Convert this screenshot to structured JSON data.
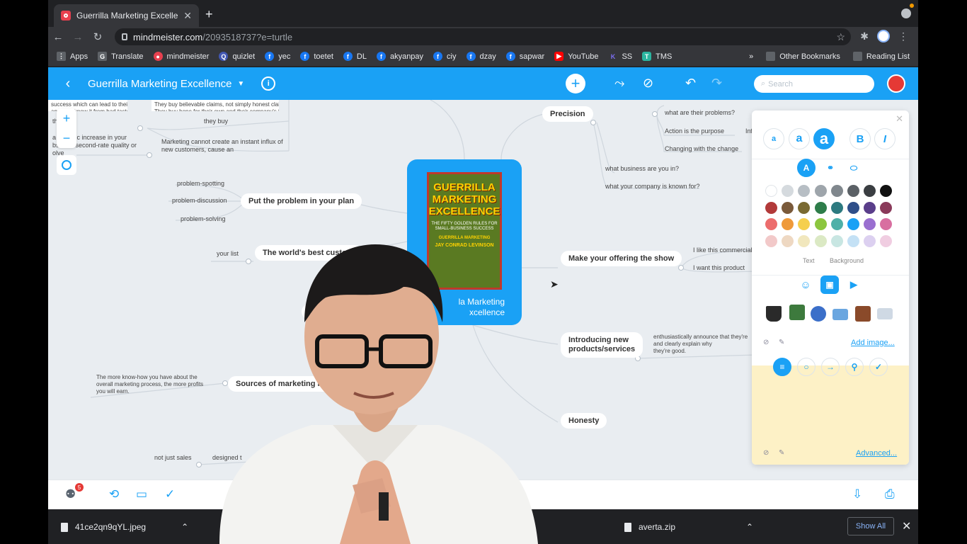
{
  "browser": {
    "tab_title": "Guerrilla Marketing Excellence",
    "url_host": "mindmeister.com",
    "url_path": "/2093518737?e=turtle",
    "bookmarks": [
      {
        "label": "Apps",
        "icon": "apps-grid-icon"
      },
      {
        "label": "Translate",
        "icon": "translate-icon"
      },
      {
        "label": "mindmeister",
        "icon": "mindmeister-icon"
      },
      {
        "label": "quizlet",
        "icon": "quizlet-icon"
      },
      {
        "label": "yec",
        "icon": "facebook-icon"
      },
      {
        "label": "toetet",
        "icon": "facebook-icon"
      },
      {
        "label": "DL",
        "icon": "facebook-icon"
      },
      {
        "label": "akyanpay",
        "icon": "facebook-icon"
      },
      {
        "label": "ciy",
        "icon": "facebook-icon"
      },
      {
        "label": "dzay",
        "icon": "facebook-icon"
      },
      {
        "label": "sapwar",
        "icon": "facebook-icon"
      },
      {
        "label": "YouTube",
        "icon": "youtube-icon"
      },
      {
        "label": "SS",
        "icon": "ss-icon"
      },
      {
        "label": "TMS",
        "icon": "tms-icon"
      }
    ],
    "overflow": "»",
    "other_bookmarks": "Other Bookmarks",
    "reading_list": "Reading List"
  },
  "app": {
    "map_title": "Guerrilla Marketing Excellence",
    "search_placeholder": "Search",
    "accent": "#1aa1f5"
  },
  "mindmap": {
    "center_label": "Guerrilla Marketing Excellence",
    "center_label_visible": "la Marketing\nxcellence",
    "book_title": "GUERRILLA MARKETING EXCELLENCE",
    "book_subtitle": "THE FIFTY GOLDEN RULES FOR SMALL-BUSINESS SUCCESS",
    "book_series": "GUERRILLA MARKETING",
    "book_author": "JAY CONRAD LEVINSON",
    "nodes": {
      "precision": "Precision",
      "put_problem": "Put the problem in your plan",
      "worlds_best": "The world's best custom",
      "make_offering": "Make your offering the show",
      "introducing": "Introducing new\nproducts/services",
      "sources": "Sources of marketing kn",
      "honesty": "Honesty",
      "c_partial": "C"
    },
    "leaves": {
      "they_buy": "they buy",
      "marketing_cannot": "Marketing cannot create an instant influx of\nnew customers, cause an",
      "problem_spotting": "problem-spotting",
      "problem_discussion": "problem-discussion",
      "problem_solving": "problem-solving",
      "your_list": "your list",
      "what_problems": "what are their problems?",
      "action_purpose": "Action is the purpose",
      "inf": "Inf",
      "changing": "Changing with the change",
      "what_business": "what business are you in?",
      "known_for": "what your company is known for?",
      "like_commercial": "I like this commercial",
      "want_product": "I want this product",
      "enthusiastically": "enthusiastically announce that they're\nand clearly explain why\nthey're good.",
      "know_how": "The more know-how you have about the\noverall marketing process, the more profits\nyou will earn.",
      "not_just_sales": "not just sales",
      "designed": "designed t",
      "note_top_left": "success which can lead to theirs.\nand they know it from bad taste.",
      "note_top_mid": "They buy believable claims, not simply honest claims.\nThey buy hope for their own and their company's future.",
      "note_left_a": "th",
      "note_left_b": "a      natic increase in your\nbst      r second-rate quality or\nolve"
    }
  },
  "panel": {
    "font_a_small": "a",
    "font_a_medium": "a",
    "font_a_large": "a",
    "bold": "B",
    "italic": "I",
    "text_label": "Text",
    "background_label": "Background",
    "add_image": "Add image...",
    "advanced": "Advanced...",
    "swatches": [
      "#ffffff",
      "#d5dade",
      "#b7bec4",
      "#9ea5ab",
      "#80878d",
      "#5b6166",
      "#3a3e42",
      "#111111",
      "#b23a3a",
      "#7a5a3a",
      "#7a6a32",
      "#2e7d4a",
      "#2d7a80",
      "#2f4f8a",
      "#5a3e8a",
      "#8a3a5a",
      "#ec6d6d",
      "#ef9a3a",
      "#f5cf4d",
      "#8cc63f",
      "#4fb0a8",
      "#1aa1f5",
      "#9a6fd0",
      "#d86fa0",
      "#f2c9c9",
      "#eed8c2",
      "#f1e7bd",
      "#dbe9c4",
      "#c8e6e2",
      "#c4e1f5",
      "#dcd0f0",
      "#f0cde1"
    ]
  },
  "bottom": {
    "badge_count": "5"
  },
  "downloads": {
    "file1": "41ce2qn9qYL.jpeg",
    "file2": "averta.zip",
    "show_all": "Show All"
  }
}
